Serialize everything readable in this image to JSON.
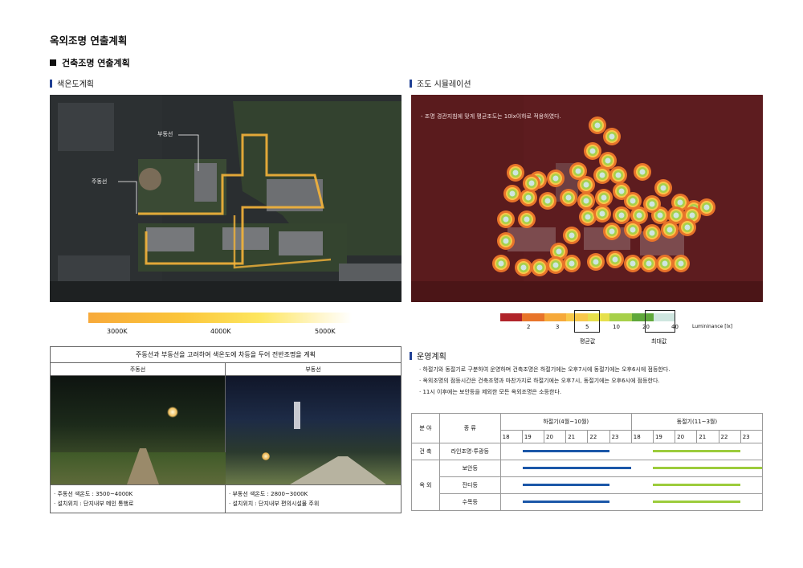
{
  "page": {
    "title": "옥외조명 연출계획",
    "section": "건축조명 연출계획"
  },
  "left": {
    "heading": "색온도계획",
    "label_sub": "부동선",
    "label_main": "주동선",
    "gradient_labels": [
      "3000K",
      "4000K",
      "5000K"
    ],
    "box_title": "주동선과 부동선을 고려하여 색온도에 차등을 두어 전반조명을 계획",
    "col_main": "주동선",
    "col_sub": "부동선",
    "main_note_1": "· 주동선  색온도 : 3500~4000K",
    "main_note_2": "· 설치위치 : 단지내부 메인 통행로",
    "sub_note_1": "· 부동선 색온도 : 2800~3000K",
    "sub_note_2": "· 설치위치 : 단지내부 편의시설물 주위"
  },
  "right": {
    "heading": "조도 시뮬레이션",
    "sim_note": "- 조명 경관지침에 맞게 평균조도는 10lx이하로 적용하였다.",
    "legend_numbers": [
      "2",
      "3",
      "5",
      "10",
      "20",
      "40"
    ],
    "legend_unit": "Lumininance [lx]",
    "legend_avg": "평균값",
    "legend_max": "최대값",
    "legend_colors": [
      "#b0242a",
      "#e8742a",
      "#f6a93a",
      "#f8c84a",
      "#e6e04c",
      "#a7d04a",
      "#5fa83a",
      "#cfe6e0"
    ],
    "ops_heading": "운영계획",
    "ops_1": "· 하절기와 동절기로 구분하여 운영하며 건축조명은 하절기에는 오후7시에 동절기에는 오후6시에 점등한다.",
    "ops_2": "· 옥외조명의 점등시간은 건축조명과 마찬가지로 하절기에는 오후7시, 동절기에는 오후6시에 점등한다.",
    "ops_3": "· 11시 이후에는 보안등을 제외한 모든 옥외조명은 소등한다."
  },
  "schedule": {
    "h_field": "분 야",
    "h_type": "종 류",
    "summer": "하절기(4월~10월)",
    "winter": "동절기(11~3월)",
    "hours": [
      "18",
      "19",
      "20",
      "21",
      "22",
      "23"
    ],
    "cat_building": "건 축",
    "cat_outdoor": "옥 외",
    "rows": [
      {
        "label": "라인조명·투광등",
        "summer_end": 23,
        "winter_end": 23
      },
      {
        "label": "보안등",
        "summer_end": 24,
        "winter_end": 24
      },
      {
        "label": "잔디등",
        "summer_end": 23,
        "winter_end": 23
      },
      {
        "label": "수목등",
        "summer_end": 23,
        "winter_end": 23
      }
    ],
    "summer_color": "#1b57a8",
    "winter_color": "#9ccc3c"
  }
}
